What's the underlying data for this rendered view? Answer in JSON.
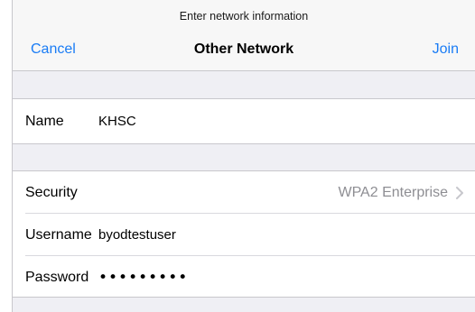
{
  "nav": {
    "prompt": "Enter network information",
    "title": "Other Network",
    "cancel_label": "Cancel",
    "join_label": "Join"
  },
  "network": {
    "name_label": "Name",
    "name_value": "KHSC"
  },
  "credentials": {
    "security_label": "Security",
    "security_value": "WPA2 Enterprise",
    "username_label": "Username",
    "username_value": "byodtestuser",
    "password_label": "Password",
    "password_value": "•••••••••"
  },
  "colors": {
    "accent": "#1a7cf5",
    "secondary_text": "#8e8e93",
    "background": "#efeff4"
  },
  "icons": {
    "security_disclosure": "chevron-right-icon"
  }
}
